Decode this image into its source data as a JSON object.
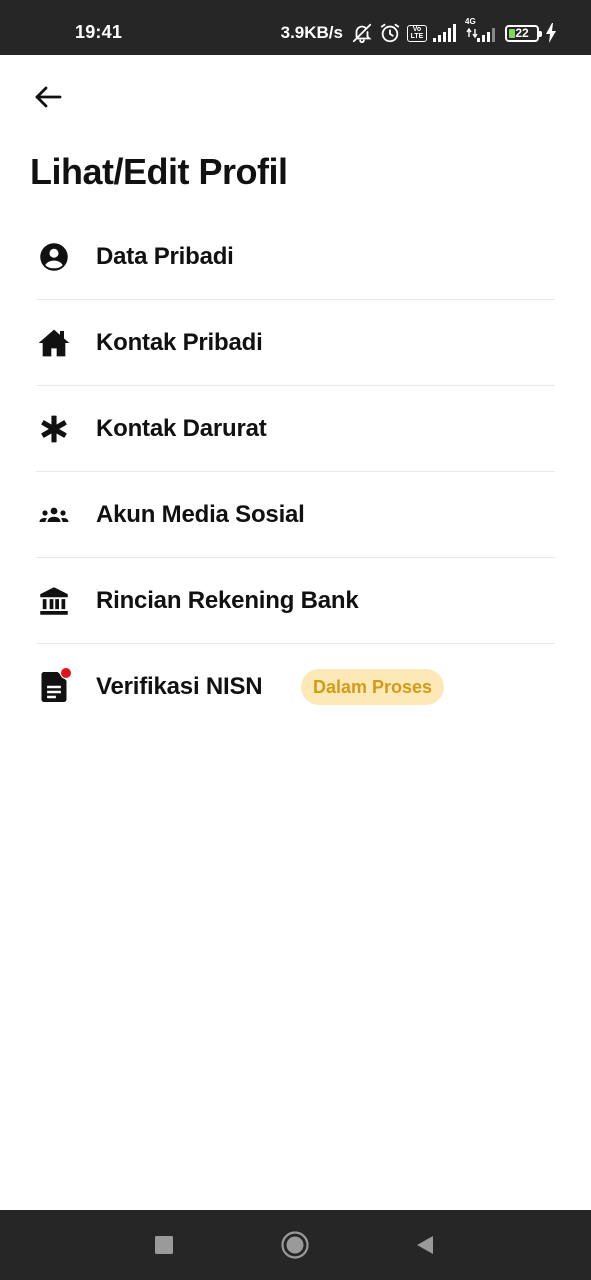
{
  "status_bar": {
    "time": "19:41",
    "net_speed": "3.9KB/s",
    "volte_label": "Vo LTE",
    "network_label": "4G",
    "battery": "22",
    "icons": [
      "bell-off-icon",
      "alarm-icon",
      "volte-icon",
      "signal-icon",
      "signal-4g-icon",
      "battery-icon",
      "charging-icon"
    ]
  },
  "header": {
    "back_icon": "arrow-left-icon",
    "title": "Lihat/Edit Profil"
  },
  "menu": {
    "items": [
      {
        "label": "Data Pribadi",
        "icon": "account-circle-icon"
      },
      {
        "label": "Kontak Pribadi",
        "icon": "home-icon"
      },
      {
        "label": "Kontak Darurat",
        "icon": "asterisk-icon"
      },
      {
        "label": "Akun Media Sosial",
        "icon": "group-icon"
      },
      {
        "label": "Rincian Rekening Bank",
        "icon": "bank-icon"
      },
      {
        "label": "Verifikasi NISN",
        "icon": "document-icon",
        "badge": "Dalam Proses",
        "notification_dot": true
      }
    ]
  },
  "colors": {
    "status_bar_bg": "#262626",
    "badge_bg": "#fde9b8",
    "badge_text": "#d39b18",
    "notification_dot": "#e0131d",
    "battery_fill": "#7ed957"
  },
  "nav_bar": {
    "icons": [
      "recents-square-icon",
      "home-circle-icon",
      "back-triangle-icon"
    ]
  }
}
